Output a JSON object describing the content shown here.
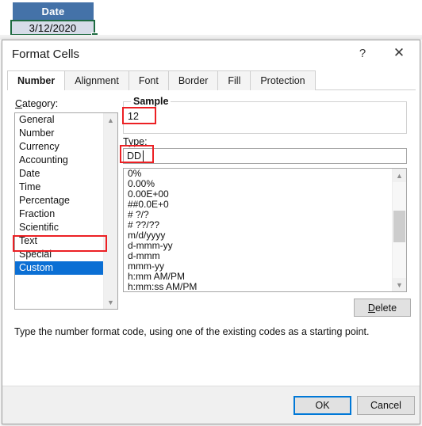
{
  "spreadsheet": {
    "column_header": "Date",
    "cell_value": "3/12/2020"
  },
  "dialog": {
    "title": "Format Cells",
    "help_icon": "question-mark-icon",
    "close_icon": "close-icon",
    "tabs": [
      {
        "label": "Number",
        "active": true
      },
      {
        "label": "Alignment",
        "active": false
      },
      {
        "label": "Font",
        "active": false
      },
      {
        "label": "Border",
        "active": false
      },
      {
        "label": "Fill",
        "active": false
      },
      {
        "label": "Protection",
        "active": false
      }
    ],
    "category": {
      "label": "Category:",
      "items": [
        "General",
        "Number",
        "Currency",
        "Accounting",
        "Date",
        "Time",
        "Percentage",
        "Fraction",
        "Scientific",
        "Text",
        "Special",
        "Custom"
      ],
      "selected": "Custom"
    },
    "sample": {
      "group_title": "Sample",
      "value": "12"
    },
    "type": {
      "label": "Type:",
      "value": "DD",
      "items": [
        "0%",
        "0.00%",
        "0.00E+00",
        "##0.0E+0",
        "# ?/?",
        "# ??/??",
        "m/d/yyyy",
        "d-mmm-yy",
        "d-mmm",
        "mmm-yy",
        "h:mm AM/PM",
        "h:mm:ss AM/PM"
      ]
    },
    "delete_label": "Delete",
    "hint": "Type the number format code, using one of the existing codes as a starting point.",
    "ok_label": "OK",
    "cancel_label": "Cancel"
  },
  "colors": {
    "header_blue": "#4472a8",
    "selection_green": "#1e6b41",
    "annotation_red": "#ec2024",
    "list_selected_blue": "#0b6fd4",
    "focus_blue": "#0078d7"
  }
}
